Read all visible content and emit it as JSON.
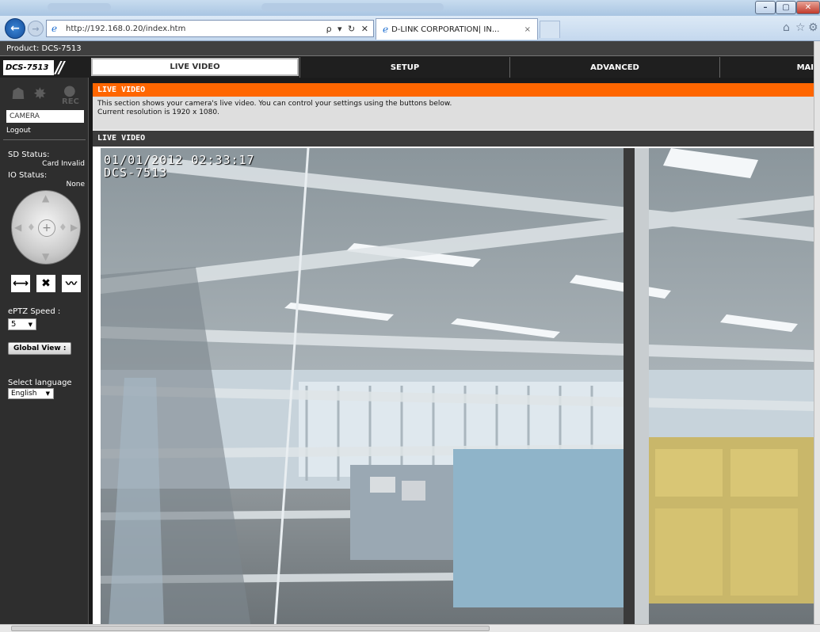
{
  "browser": {
    "url": "http://192.168.0.20/index.htm",
    "tab_title": "D-LINK CORPORATION| IN...",
    "close_tab_glyph": "×",
    "url_tools": "ρ ▾ ↻ ✕",
    "min_glyph": "–",
    "max_glyph": "▢",
    "close_glyph": "✕",
    "toolbar_icons": [
      "home-icon",
      "star-icon",
      "gear-icon"
    ]
  },
  "product": "Product: DCS-7513",
  "logo": "DCS-7513",
  "menu": {
    "live_video": "LIVE VIDEO",
    "setup": "SETUP",
    "advanced": "ADVANCED",
    "maintenance": "MAI"
  },
  "sidebar": {
    "camera": "CAMERA",
    "logout": "Logout",
    "sd_status_label": "SD Status:",
    "sd_status_value": "Card Invalid",
    "io_status_label": "IO Status:",
    "io_status_value": "None",
    "rec_label": "REC",
    "eptz_speed_label": "ePTZ Speed :",
    "eptz_speed_value": "5",
    "global_view": "Global View :",
    "language_label": "Select language",
    "language_value": "English"
  },
  "main": {
    "section_title": "LIVE VIDEO",
    "desc_line1": "This section shows your camera's live video. You can control your settings using the buttons below.",
    "desc_line2": "Current resolution is 1920 x 1080.",
    "video_title": "LIVE VIDEO",
    "osd_timestamp": "01/01/2012 02:33:17",
    "osd_camera": "DCS-7513"
  },
  "colors": {
    "accent_orange": "#ff6600",
    "menubar": "#1f1f1f",
    "sidebar": "#2e2e2e"
  }
}
